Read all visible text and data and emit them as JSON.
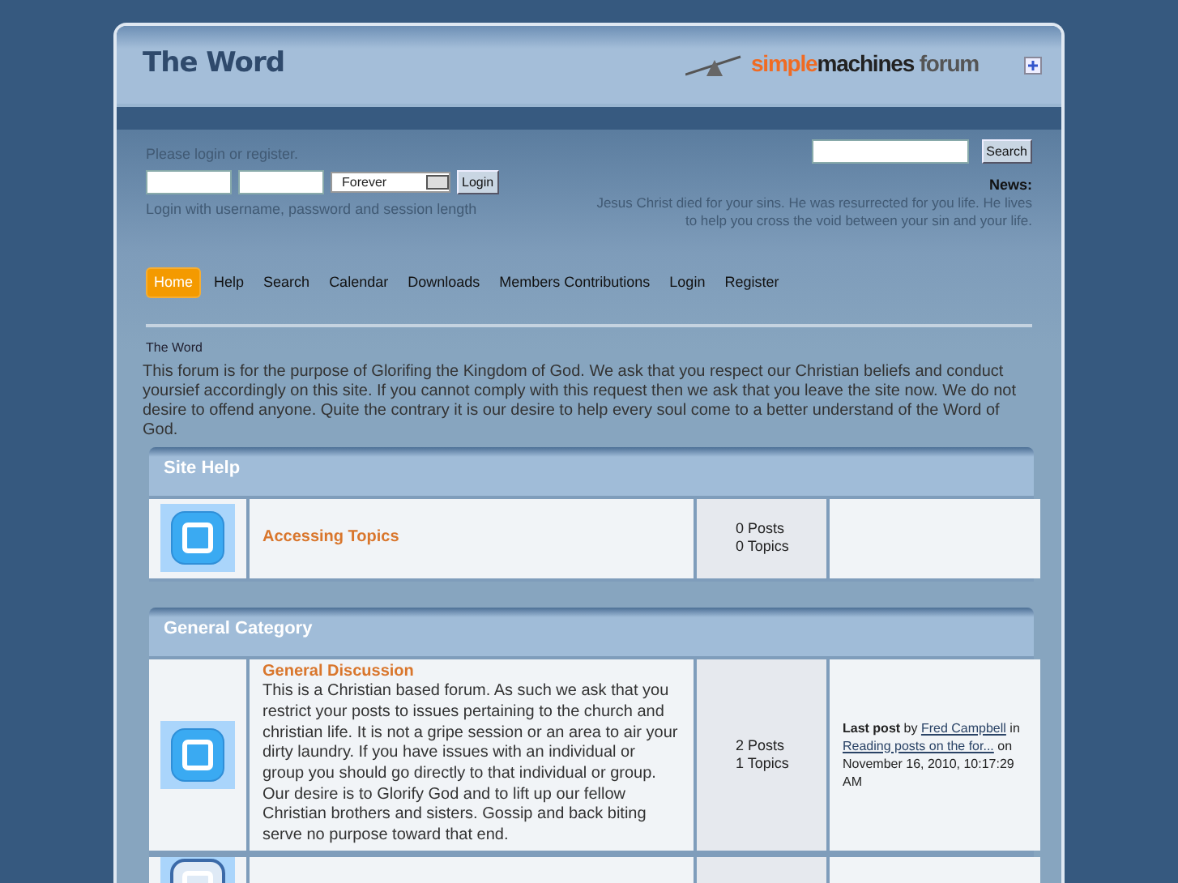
{
  "header": {
    "title": "The Word",
    "logo": {
      "part_1": "simple",
      "part_2": "machines",
      "part_3": "forum"
    }
  },
  "login": {
    "prompt": "Please login or register.",
    "session": "Forever",
    "button": "Login",
    "hint": "Login with username, password and session length"
  },
  "search": {
    "button": "Search"
  },
  "news": {
    "label": "News:",
    "text": "Jesus Christ died for your sins.  He was resurrected for you life.  He lives to help you cross the void between your sin and your life."
  },
  "menu": [
    {
      "label": "Home",
      "selected": true
    },
    {
      "label": "Help",
      "selected": false
    },
    {
      "label": "Search",
      "selected": false
    },
    {
      "label": "Calendar",
      "selected": false
    },
    {
      "label": "Downloads",
      "selected": false
    },
    {
      "label": "Members Contributions",
      "selected": false
    },
    {
      "label": "Login",
      "selected": false
    },
    {
      "label": "Register",
      "selected": false
    }
  ],
  "breadcrumb": "The Word",
  "intro": "This forum is for the purpose of Glorifing the Kingdom of God. We ask that you respect our Christian beliefs and conduct yoursief accordingly on this site. If you cannot comply with this request then we ask that you leave the site now. We do not desire to offend anyone. Quite the contrary it is our desire to help every soul come to a better understand of the Word of God.",
  "categories": [
    {
      "title": "Site Help",
      "boards": [
        {
          "name": "Accessing Topics",
          "posts": "0 Posts",
          "topics": "0 Topics"
        }
      ]
    },
    {
      "title": "General Category",
      "boards": [
        {
          "name": "General Discussion",
          "description": "This is a Christian based forum. As such we ask that you restrict your posts to issues pertaining to the church and christian life. It is not a gripe session or an area to air your dirty laundry. If you have issues with an individual or group you should go directly to that individual or group. Our desire is to Glorify God and to lift up our fellow Christian brothers and sisters. Gossip and back biting serve no purpose toward that end.",
          "posts": "2 Posts",
          "topics": "1 Topics",
          "last_post": {
            "lead": "**Last post** by",
            "author": "Fred Campbell",
            "in": "in",
            "topic": "Reading posts on the for...",
            "date": "on November 16, 2010, 10:17:29 AM"
          }
        },
        {
          "new": true
        }
      ]
    }
  ]
}
